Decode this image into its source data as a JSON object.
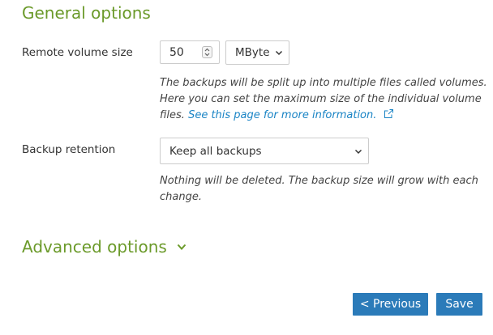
{
  "general": {
    "title": "General options"
  },
  "volume_size": {
    "label": "Remote volume size",
    "value": "50",
    "unit": "MByte",
    "help_line1": "The backups will be split up into multiple files called volumes.",
    "help_line2": "Here you can set the maximum size of the individual volume",
    "help_line3_prefix": "files.",
    "help_link": "See this page for more information."
  },
  "retention": {
    "label": "Backup retention",
    "value": "Keep all backups",
    "help_line1": "Nothing will be deleted. The backup size will grow with each",
    "help_line2": "change."
  },
  "advanced": {
    "title": "Advanced options"
  },
  "buttons": {
    "previous": "< Previous",
    "save": "Save"
  },
  "colors": {
    "heading": "#6b9a2a",
    "link": "#1a84c5",
    "button": "#2b7bb9"
  },
  "icons": {
    "spinner": "number-spinner-icon",
    "caret": "chevron-down-icon",
    "external": "external-link-icon",
    "expand": "chevron-down-icon"
  }
}
